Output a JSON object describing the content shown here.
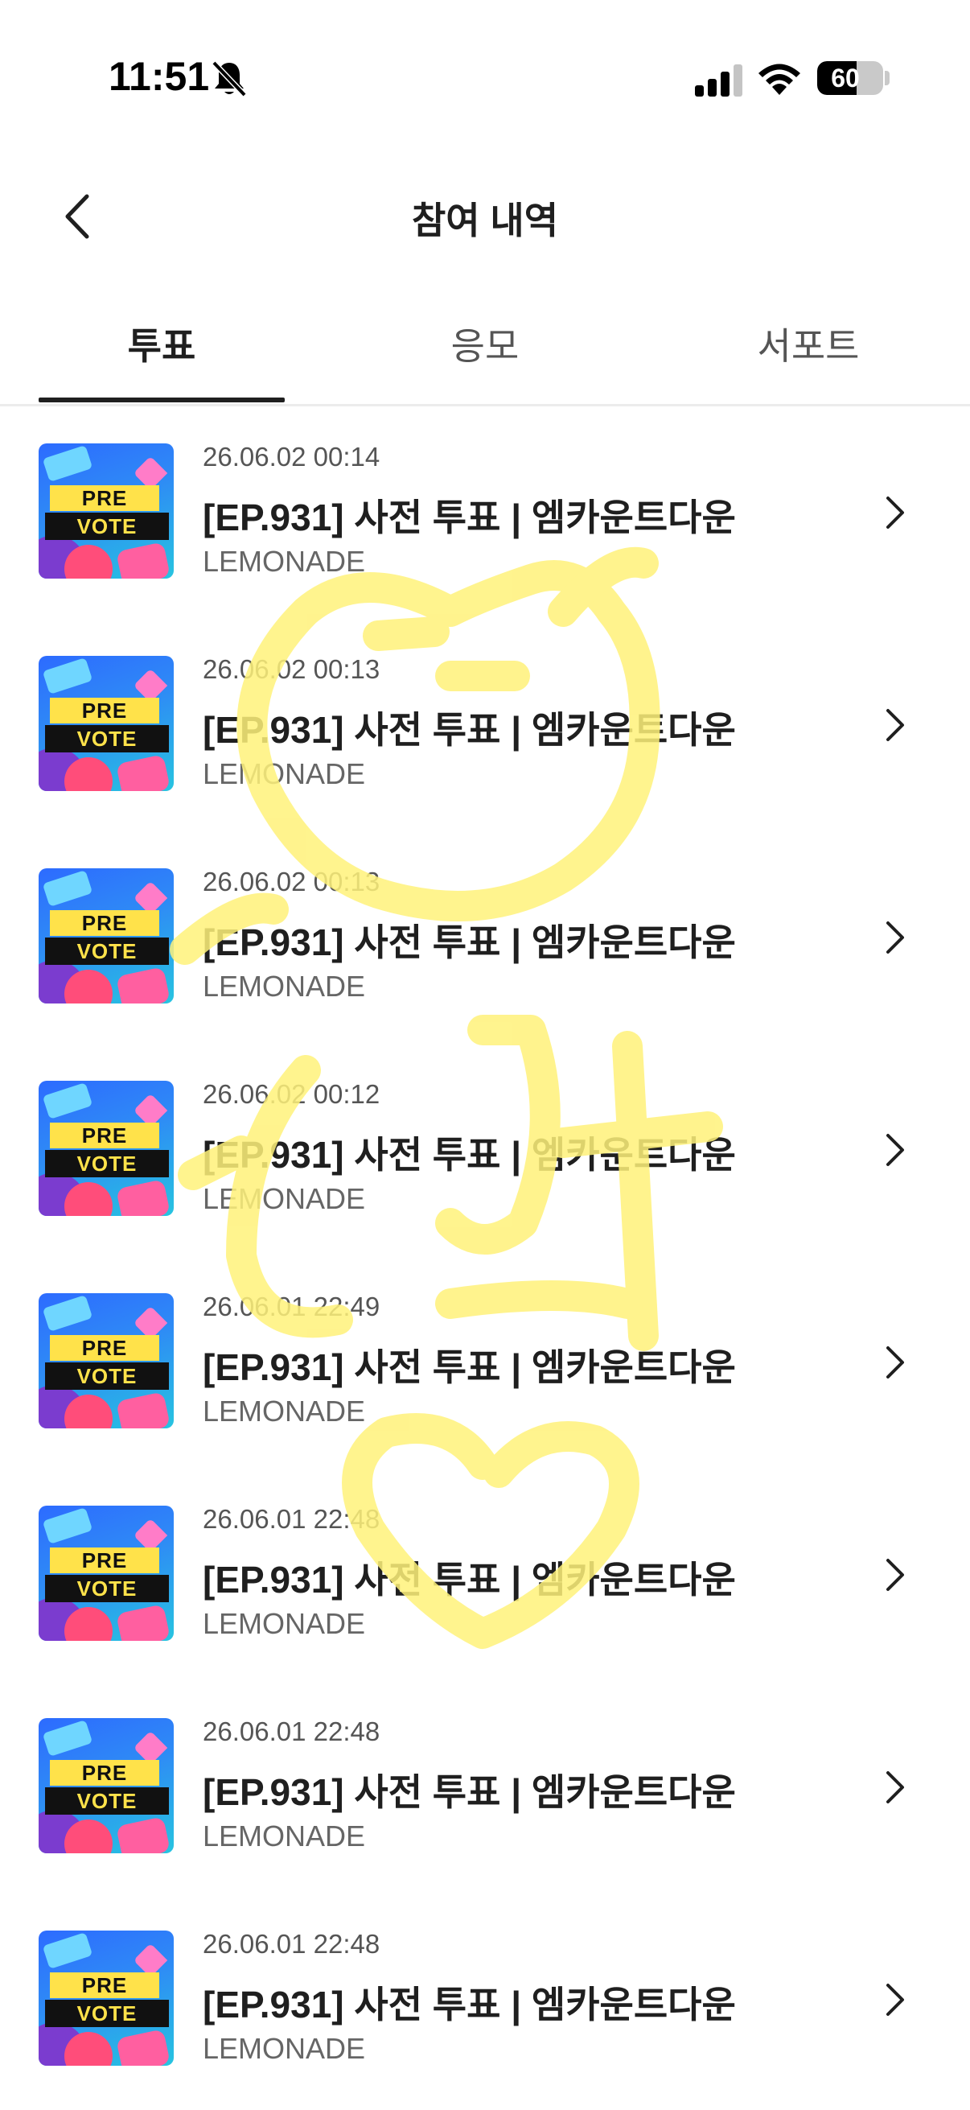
{
  "status_bar": {
    "time": "11:51",
    "battery_percent": "60",
    "battery_level": 0.6,
    "bell_icon": "bell-slash-icon",
    "signal_icon": "cellular-signal-icon",
    "wifi_icon": "wifi-icon"
  },
  "header": {
    "title": "참여 내역",
    "back_icon": "chevron-left-icon"
  },
  "tabs": [
    {
      "label": "투표",
      "active": true
    },
    {
      "label": "응모",
      "active": false
    },
    {
      "label": "서포트",
      "active": false
    }
  ],
  "thumbnail": {
    "line1": "PRE",
    "line2": "VOTE"
  },
  "items": [
    {
      "date": "26.06.02 00:14",
      "title": "[EP.931] 사전 투표 | 엠카운트다운",
      "artist": "LEMONADE"
    },
    {
      "date": "26.06.02 00:13",
      "title": "[EP.931] 사전 투표 | 엠카운트다운",
      "artist": "LEMONADE"
    },
    {
      "date": "26.06.02 00:13",
      "title": "[EP.931] 사전 투표 | 엠카운트다운",
      "artist": "LEMONADE"
    },
    {
      "date": "26.06.02 00:12",
      "title": "[EP.931] 사전 투표 | 엠카운트다운",
      "artist": "LEMONADE"
    },
    {
      "date": "26.06.01 22:49",
      "title": "[EP.931] 사전 투표 | 엠카운트다운",
      "artist": "LEMONADE"
    },
    {
      "date": "26.06.01 22:48",
      "title": "[EP.931] 사전 투표 | 엠카운트다운",
      "artist": "LEMONADE"
    },
    {
      "date": "26.06.01 22:48",
      "title": "[EP.931] 사전 투표 | 엠카운트다운",
      "artist": "LEMONADE"
    },
    {
      "date": "26.06.01 22:48",
      "title": "[EP.931] 사전 투표 | 엠카운트다운",
      "artist": "LEMONADE"
    }
  ],
  "colors": {
    "text_primary": "#1f1f1f",
    "text_secondary": "#555555",
    "doodle_yellow": "#fff27a"
  }
}
